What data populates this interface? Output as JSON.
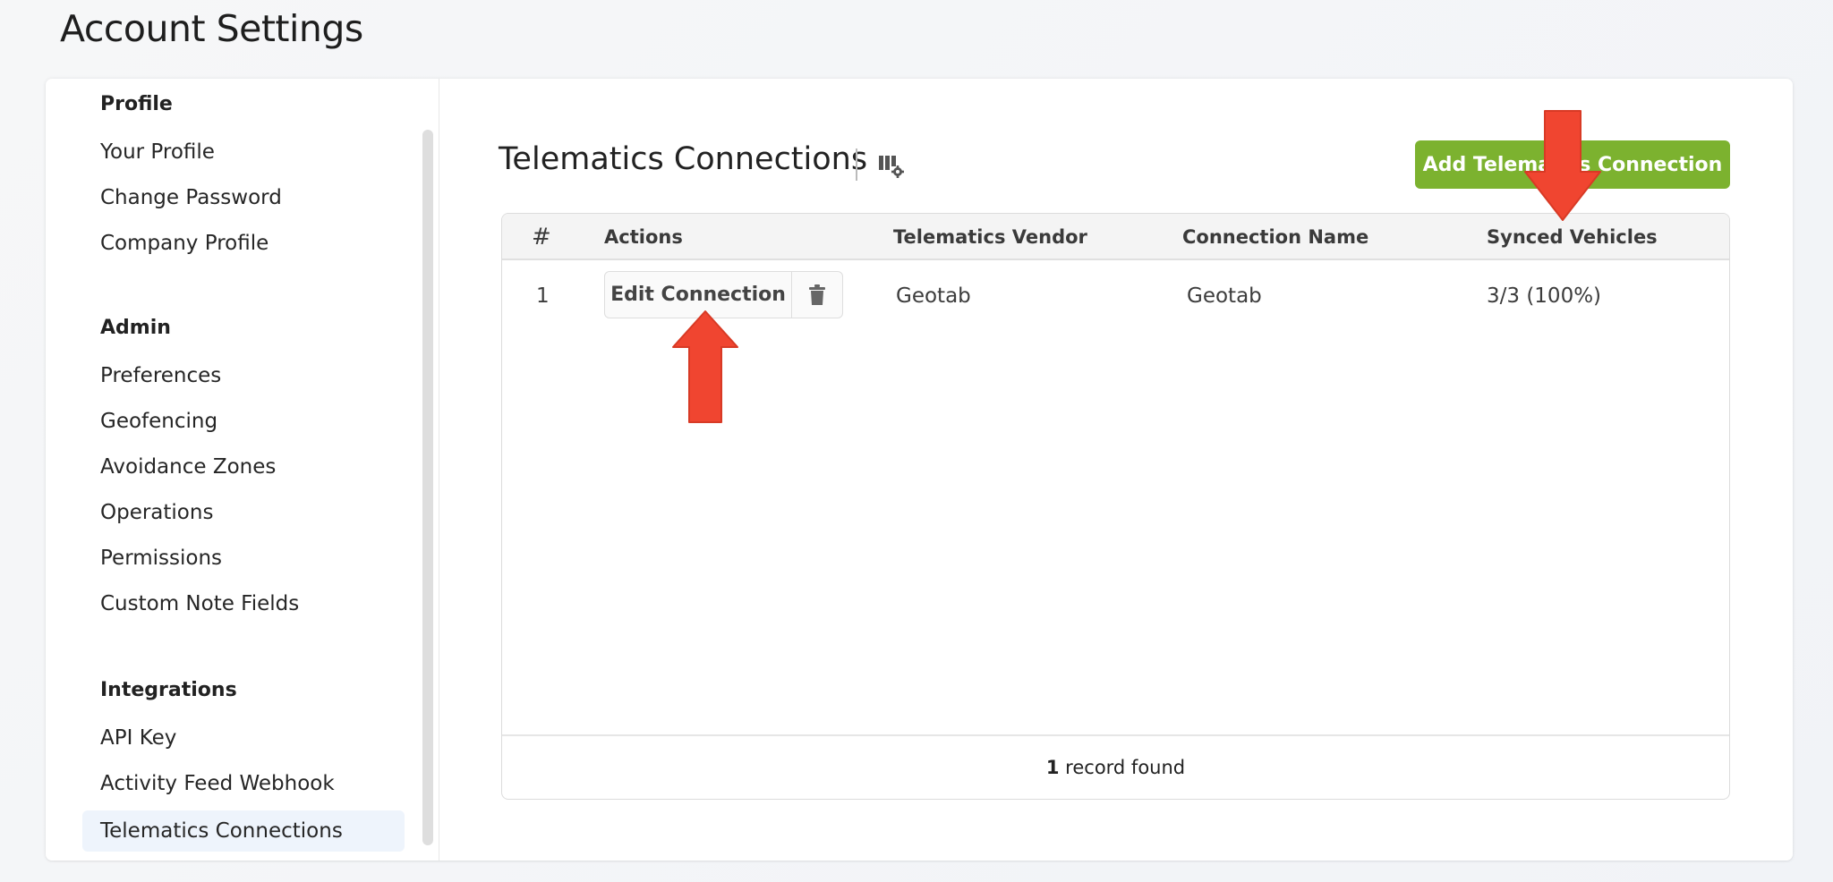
{
  "page": {
    "title": "Account Settings"
  },
  "sidebar": {
    "groups": [
      {
        "title": "Profile",
        "items": [
          "Your Profile",
          "Change Password",
          "Company Profile"
        ]
      },
      {
        "title": "Admin",
        "items": [
          "Preferences",
          "Geofencing",
          "Avoidance Zones",
          "Operations",
          "Permissions",
          "Custom Note Fields"
        ]
      },
      {
        "title": "Integrations",
        "items": [
          "API Key",
          "Activity Feed Webhook",
          "Telematics Connections"
        ]
      }
    ],
    "active_item": "Telematics Connections"
  },
  "main": {
    "title": "Telematics Connections",
    "columns_icon": "column-settings-icon",
    "add_button_label": "Add Telematics Connection",
    "table": {
      "columns": [
        "#",
        "Actions",
        "Telematics Vendor",
        "Connection Name",
        "Synced Vehicles"
      ],
      "rows": [
        {
          "index": "1",
          "edit_label": "Edit Connection",
          "delete_icon": "trash-icon",
          "vendor": "Geotab",
          "connection_name": "Geotab",
          "synced_vehicles": "3/3 (100%)"
        }
      ],
      "footer": {
        "count": "1",
        "suffix": " record found"
      }
    }
  },
  "annotations": {
    "arrow_color": "#f04530",
    "arrows": [
      "arrow-up-pointing-edit-connection",
      "arrow-down-pointing-synced-vehicles"
    ]
  },
  "colors": {
    "accent_green": "#7cb22f",
    "active_nav_bg": "#eef4fc"
  }
}
